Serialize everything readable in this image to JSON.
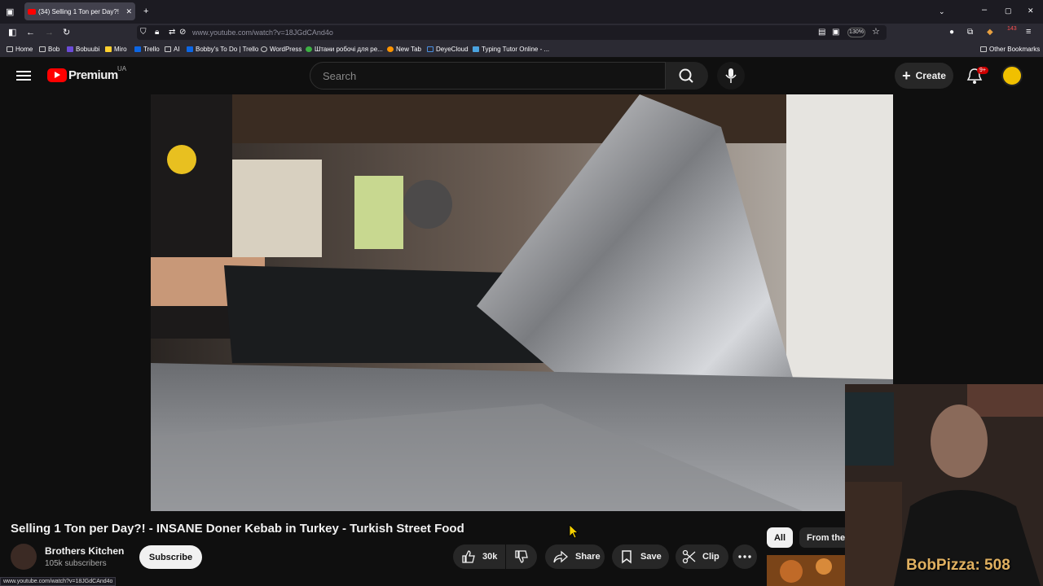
{
  "browser": {
    "tab_title": "(34) Selling 1 Ton per Day?!",
    "url": "www.youtube.com/watch?v=18JGdCAnd4o",
    "zoom": "130%",
    "ext_badge": "143",
    "bookmarks": [
      "Home",
      "Bob",
      "Bobuubi",
      "Miro",
      "Trello",
      "AI",
      "Bobby's To Do | Trello",
      "WordPress",
      "Штани робочі для ре...",
      "New Tab",
      "DeyeCloud",
      "Typing Tutor Online - ..."
    ],
    "other_bookmarks": "Other Bookmarks",
    "status_url": "www.youtube.com/watch?v=18JGdCAnd4o"
  },
  "yt": {
    "logo_text": "Premium",
    "country": "UA",
    "search_placeholder": "Search",
    "create_label": "Create",
    "notif_count": "9+"
  },
  "video": {
    "title": "Selling 1 Ton per Day?! - INSANE Doner Kebab in Turkey - Turkish Street Food",
    "channel": "Brothers Kitchen",
    "subscribers": "105k subscribers",
    "subscribe_label": "Subscribe",
    "likes": "30k",
    "share_label": "Share",
    "save_label": "Save",
    "clip_label": "Clip"
  },
  "chips": {
    "all": "All",
    "from": "From the"
  },
  "overlay": {
    "text": "BobPizza: 508"
  },
  "icons": {
    "menu": "hamburger-icon",
    "search": "search-icon",
    "mic": "microphone-icon",
    "bell": "bell-icon",
    "like": "thumbs-up-icon",
    "dislike": "thumbs-down-icon",
    "share": "share-icon",
    "save": "bookmark-icon",
    "clip": "scissors-icon",
    "more": "more-horizontal-icon"
  },
  "colors": {
    "accent": "#ff0000",
    "background": "#0f0f0f"
  }
}
